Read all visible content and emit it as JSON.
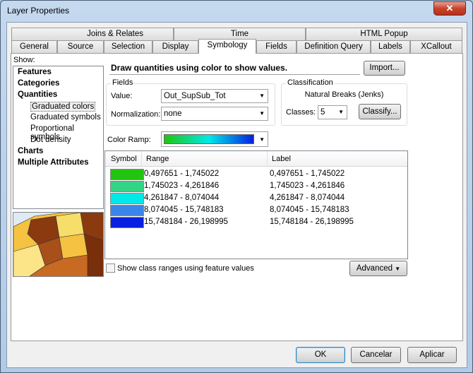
{
  "window": {
    "title": "Layer Properties",
    "close_icon": "close-icon"
  },
  "tabs_row1": [
    "Joins & Relates",
    "Time",
    "HTML Popup"
  ],
  "tabs_row2": [
    "General",
    "Source",
    "Selection",
    "Display",
    "Symbology",
    "Fields",
    "Definition Query",
    "Labels",
    "XCallout"
  ],
  "active_tab": "Symbology",
  "show": {
    "label": "Show:",
    "items": [
      {
        "label": "Features",
        "bold": true
      },
      {
        "label": "Categories",
        "bold": true
      },
      {
        "label": "Quantities",
        "bold": true
      },
      {
        "label": "Graduated colors",
        "selected": true
      },
      {
        "label": "Graduated symbols"
      },
      {
        "label": "Proportional symbols"
      },
      {
        "label": "Dot density"
      },
      {
        "label": "Charts",
        "bold": true
      },
      {
        "label": "Multiple Attributes",
        "bold": true
      }
    ]
  },
  "description": "Draw quantities using color to show values.",
  "import_button": "Import...",
  "fields": {
    "title": "Fields",
    "value_label": "Value:",
    "value": "Out_SupSub_Tot",
    "normalization_label": "Normalization:",
    "normalization": "none"
  },
  "classification": {
    "title": "Classification",
    "method": "Natural Breaks (Jenks)",
    "classes_label": "Classes:",
    "classes": "5",
    "classify_button": "Classify..."
  },
  "color_ramp": {
    "label": "Color Ramp:",
    "from": "#22c40f",
    "to": "#0820e0"
  },
  "table": {
    "headers": [
      "Symbol",
      "Range",
      "Label"
    ],
    "rows": [
      {
        "color": "#22c40f",
        "range": "0,497651 - 1,745022",
        "label": "0,497651 - 1,745022"
      },
      {
        "color": "#33d486",
        "range": "1,745023 - 4,261846",
        "label": "1,745023 - 4,261846"
      },
      {
        "color": "#00e8e8",
        "range": "4,261847 - 8,074044",
        "label": "4,261847 - 8,074044"
      },
      {
        "color": "#3a86e8",
        "range": "8,074045 - 15,748183",
        "label": "8,074045 - 15,748183"
      },
      {
        "color": "#0820e0",
        "range": "15,748184 - 26,198995",
        "label": "15,748184 - 26,198995"
      }
    ]
  },
  "show_class_ranges": {
    "label": "Show class ranges using feature values",
    "checked": false
  },
  "advanced_button": "Advanced",
  "footer": {
    "ok": "OK",
    "cancel": "Cancelar",
    "apply": "Aplicar"
  }
}
